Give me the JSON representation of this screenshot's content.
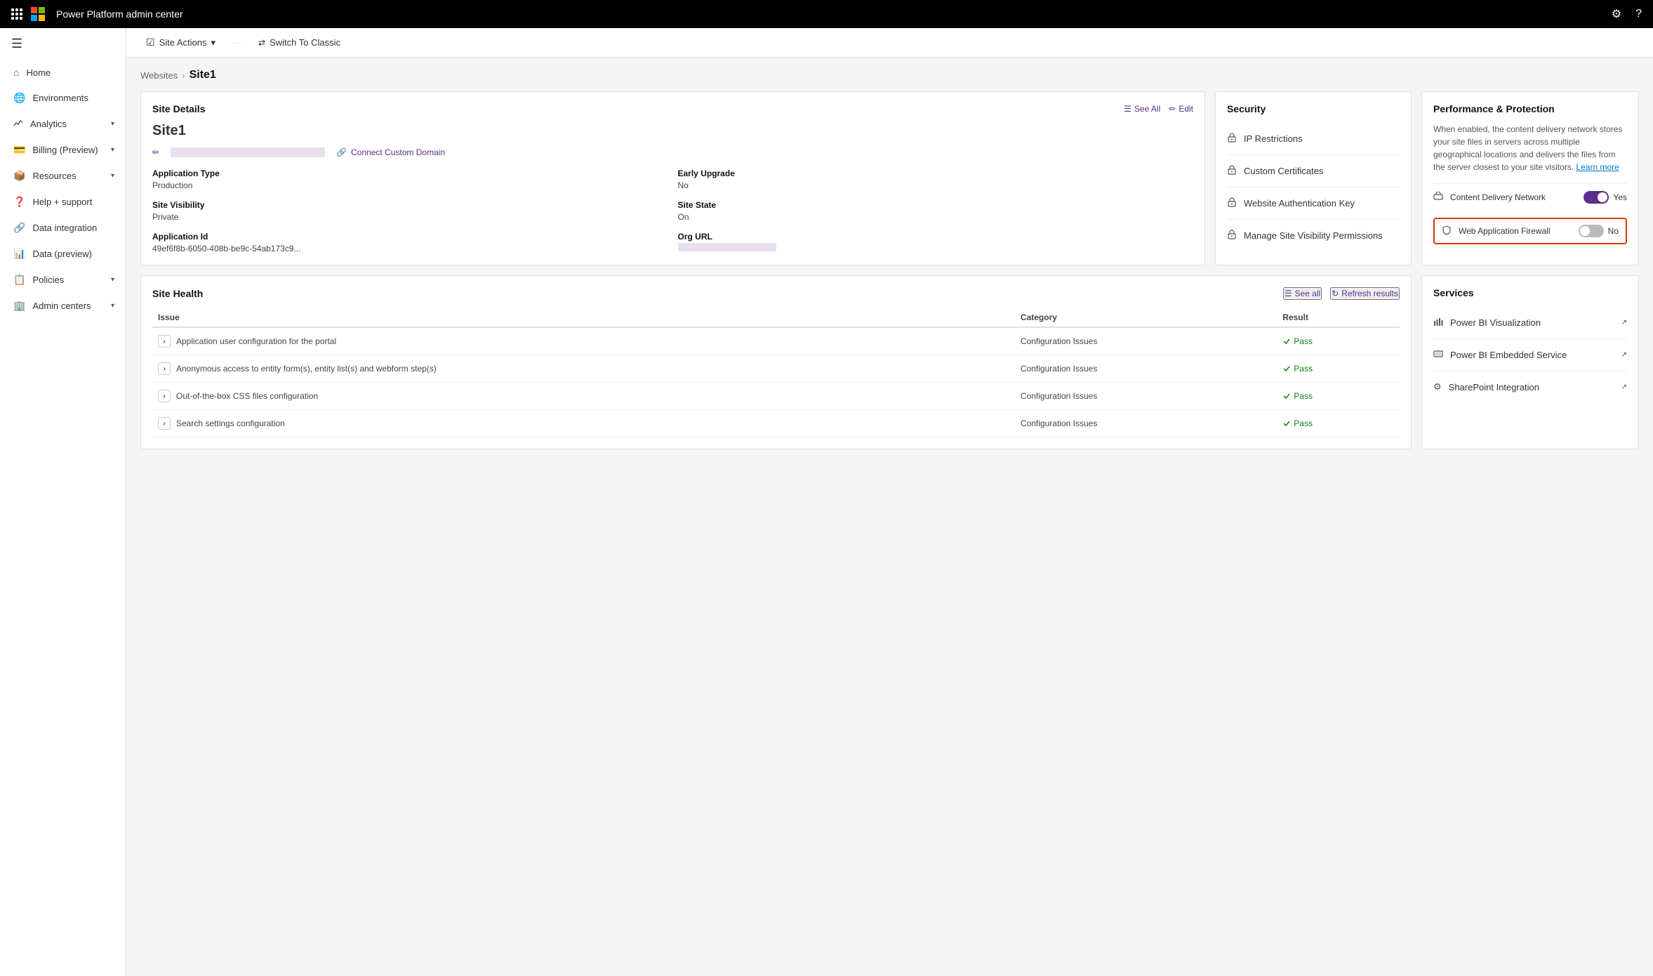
{
  "topbar": {
    "title": "Power Platform admin center",
    "settings_icon": "⚙",
    "help_icon": "?"
  },
  "sidebar": {
    "menu_icon": "☰",
    "items": [
      {
        "id": "home",
        "label": "Home",
        "icon": "⌂",
        "has_chevron": false
      },
      {
        "id": "environments",
        "label": "Environments",
        "icon": "🌐",
        "has_chevron": false
      },
      {
        "id": "analytics",
        "label": "Analytics",
        "icon": "📈",
        "has_chevron": true
      },
      {
        "id": "billing",
        "label": "Billing (Preview)",
        "icon": "💳",
        "has_chevron": true
      },
      {
        "id": "resources",
        "label": "Resources",
        "icon": "📦",
        "has_chevron": true
      },
      {
        "id": "help",
        "label": "Help + support",
        "icon": "❓",
        "has_chevron": false
      },
      {
        "id": "data-integration",
        "label": "Data integration",
        "icon": "🔗",
        "has_chevron": false
      },
      {
        "id": "data-preview",
        "label": "Data (preview)",
        "icon": "📊",
        "has_chevron": false
      },
      {
        "id": "policies",
        "label": "Policies",
        "icon": "📋",
        "has_chevron": true
      },
      {
        "id": "admin-centers",
        "label": "Admin centers",
        "icon": "🏢",
        "has_chevron": true
      }
    ]
  },
  "toolbar": {
    "site_actions_label": "Site Actions",
    "more_icon": "···",
    "switch_classic_label": "Switch To Classic"
  },
  "breadcrumb": {
    "parent": "Websites",
    "current": "Site1"
  },
  "site_details": {
    "card_title": "Site Details",
    "see_all_label": "See All",
    "edit_label": "Edit",
    "site_name": "Site1",
    "connect_domain_label": "Connect Custom Domain",
    "fields": [
      {
        "label": "Application Type",
        "value": "Production"
      },
      {
        "label": "Early Upgrade",
        "value": "No"
      },
      {
        "label": "Site Visibility",
        "value": "Private"
      },
      {
        "label": "Site State",
        "value": "On"
      },
      {
        "label": "Application Id",
        "value": "49ef6f8b-6050-408b-be9c-54ab173c9..."
      },
      {
        "label": "Org URL",
        "value": ""
      }
    ]
  },
  "security": {
    "card_title": "Security",
    "items": [
      {
        "id": "ip-restrictions",
        "label": "IP Restrictions",
        "icon": "🔒"
      },
      {
        "id": "custom-certificates",
        "label": "Custom Certificates",
        "icon": "🔒"
      },
      {
        "id": "website-auth-key",
        "label": "Website Authentication Key",
        "icon": "🔒"
      },
      {
        "id": "manage-site-visibility",
        "label": "Manage Site Visibility Permissions",
        "icon": "🔒"
      }
    ]
  },
  "performance_protection": {
    "card_title": "Performance & Protection",
    "description": "When enabled, the content delivery network stores your site files in servers across multiple geographical locations and delivers the files from the server closest to your site visitors.",
    "learn_more": "Learn more",
    "cdn_label": "Content Delivery Network",
    "cdn_value": "Yes",
    "cdn_enabled": true,
    "waf_label": "Web Application Firewall",
    "waf_value": "No",
    "waf_enabled": false
  },
  "site_health": {
    "card_title": "Site Health",
    "see_all_label": "See all",
    "refresh_label": "Refresh results",
    "columns": [
      "Issue",
      "Category",
      "Result"
    ],
    "rows": [
      {
        "issue": "Application user configuration for the portal",
        "category": "Configuration Issues",
        "result": "Pass"
      },
      {
        "issue": "Anonymous access to entity form(s), entity list(s) and webform step(s)",
        "category": "Configuration Issues",
        "result": "Pass"
      },
      {
        "issue": "Out-of-the-box CSS files configuration",
        "category": "Configuration Issues",
        "result": "Pass"
      },
      {
        "issue": "Search settings configuration",
        "category": "Configuration Issues",
        "result": "Pass"
      }
    ]
  },
  "services": {
    "card_title": "Services",
    "items": [
      {
        "id": "power-bi-viz",
        "label": "Power BI Visualization",
        "icon": "📊"
      },
      {
        "id": "power-bi-embedded",
        "label": "Power BI Embedded Service",
        "icon": "🖥"
      },
      {
        "id": "sharepoint",
        "label": "SharePoint Integration",
        "icon": "⚙"
      }
    ]
  }
}
